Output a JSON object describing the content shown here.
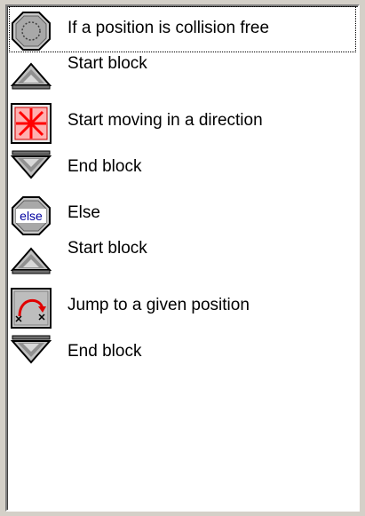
{
  "actions": [
    {
      "label": "If a position is collision free",
      "icon": "collision-free-icon",
      "selected": true
    },
    {
      "label": "Start block",
      "icon": "start-block-icon",
      "selected": false
    },
    {
      "label": "Start moving in a direction",
      "icon": "move-direction-icon",
      "selected": false
    },
    {
      "label": "End block",
      "icon": "end-block-icon",
      "selected": false
    },
    {
      "label": "Else",
      "icon": "else-icon",
      "selected": false,
      "icon_text": "else"
    },
    {
      "label": "Start block",
      "icon": "start-block-icon",
      "selected": false
    },
    {
      "label": "Jump to a given position",
      "icon": "jump-position-icon",
      "selected": false
    },
    {
      "label": "End block",
      "icon": "end-block-icon",
      "selected": false
    }
  ]
}
